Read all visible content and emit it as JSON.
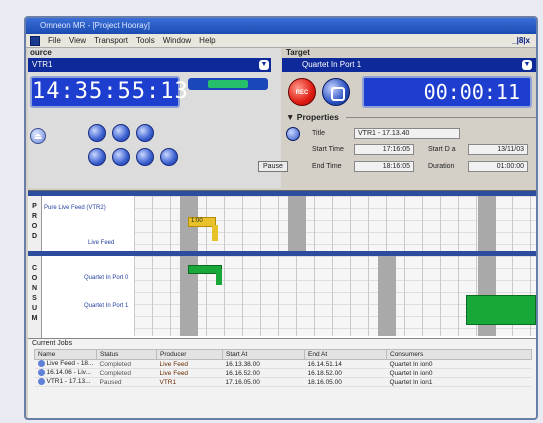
{
  "window": {
    "title": "Omneon MR - [Project Hooray]"
  },
  "menu": [
    "File",
    "View",
    "Transport",
    "Tools",
    "Window",
    "Help"
  ],
  "window_controls": "_|8|x",
  "source": {
    "header": "ource",
    "selected": "VTR1",
    "timecode": "14:35:55:13",
    "pause_label": "Pause"
  },
  "target": {
    "header": "Target",
    "selected": "Quartet In Port 1",
    "rec_label": "REC",
    "timecode": "00:00:11"
  },
  "properties": {
    "title": "Properties",
    "title_label": "Title",
    "title_value": "VTR1 - 17.13.40",
    "start_time_label": "Start Time",
    "start_time_value": "17:16:05",
    "start_date_label": "Start D a",
    "start_date_value": "13/11/03",
    "end_time_label": "End Time",
    "end_time_value": "18:16:05",
    "duration_label": "Duration",
    "duration_value": "01:00:00"
  },
  "timeline": {
    "producers_label": [
      "P",
      "R",
      "O",
      "D"
    ],
    "producer_row": "Pure Live Feed (VTR2)",
    "producer_sub": "Live Feed",
    "producer_block_text": "1:00",
    "consumers_label": [
      "C",
      "O",
      "N",
      "S",
      "U",
      "M"
    ],
    "consumer_rows": [
      "Quartet In Port 0",
      "Quartet In Port 1"
    ],
    "colors": {
      "ruler": "#2c4d9e",
      "green": "#18a83a",
      "yellow": "#e7c22a"
    }
  },
  "jobs": {
    "title": "Current Jobs",
    "columns": [
      "Name",
      "Status",
      "Producer",
      "Start At",
      "End At",
      "Consumers"
    ],
    "rows": [
      [
        "Live Feed - 18...",
        "Completed",
        "Live Feed",
        "16.13.38.00",
        "16.14.51.14",
        "Quartet In ion0"
      ],
      [
        "16.14.06 - Liv...",
        "Completed",
        "Live Feed",
        "16.16.52.00",
        "16.18.52.00",
        "Quartet In ion0"
      ],
      [
        "VTR1 - 17.13...",
        "Paused",
        "VTR1",
        "17.16.05.00",
        "18.16.05.00",
        "Quartet In ion1"
      ]
    ]
  }
}
